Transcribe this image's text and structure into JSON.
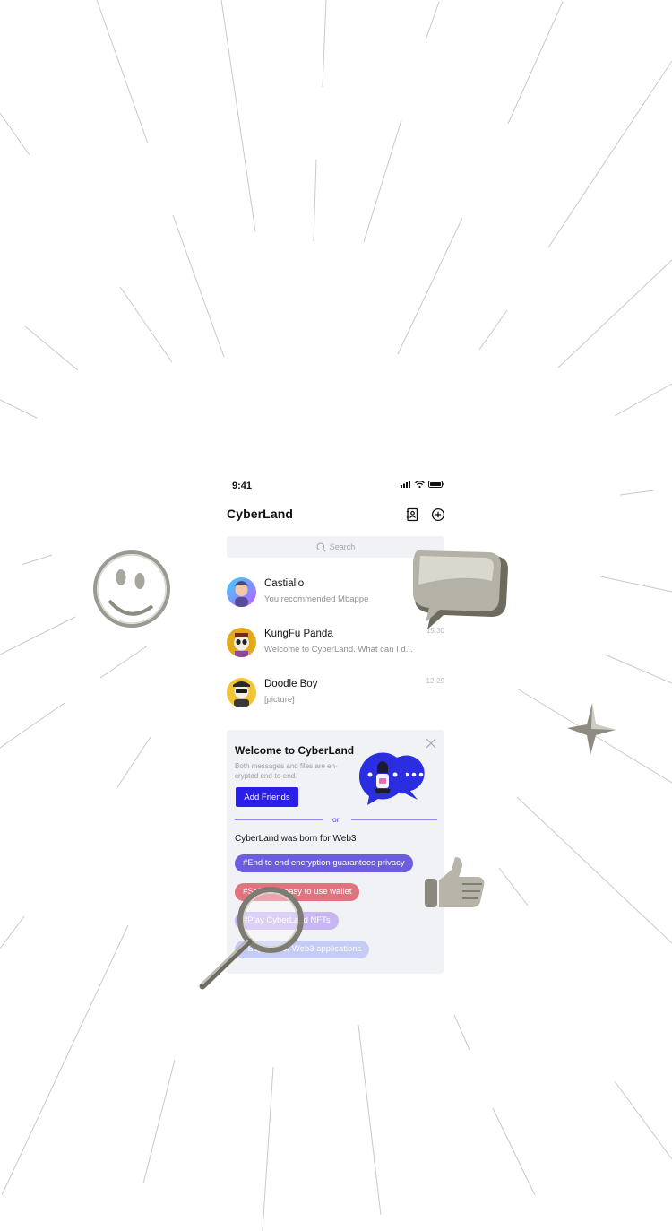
{
  "status": {
    "time": "9:41"
  },
  "header": {
    "title": "CyberLand",
    "contacts_icon": "contacts-book-icon",
    "add_icon": "plus-circle-icon"
  },
  "search": {
    "placeholder": "Search",
    "icon": "search-icon"
  },
  "chats": [
    {
      "name": "Castiallo",
      "preview": "You recommended Mbappe",
      "time": ""
    },
    {
      "name": "KungFu Panda",
      "preview": "Welcome to CyberLand. What can I d...",
      "time": "15:30"
    },
    {
      "name": "Doodle Boy",
      "preview": "[picture]",
      "time": "12-29"
    }
  ],
  "welcome": {
    "title": "Welcome to CyberLand",
    "description": "Both messages and files are en-crypted end-to-end.",
    "add_friends_label": "Add Friends",
    "or_label": "or",
    "born_text": "CyberLand was born for Web3",
    "tags": [
      {
        "text": "#End to end encryption guarantees privacy",
        "color": "#6c5ce0"
      },
      {
        "text": "#Safe and easy to use wallet",
        "color": "#e0747e"
      },
      {
        "text": "#Play CyberLand NFTs",
        "color": "#c8b6f2"
      },
      {
        "text": "#Support for Web3 applications",
        "color": "#c4cbf4"
      }
    ]
  },
  "colors": {
    "accent": "#2b1ee6",
    "card_bg": "#f1f2f6",
    "search_bg": "#f1f2f5"
  }
}
